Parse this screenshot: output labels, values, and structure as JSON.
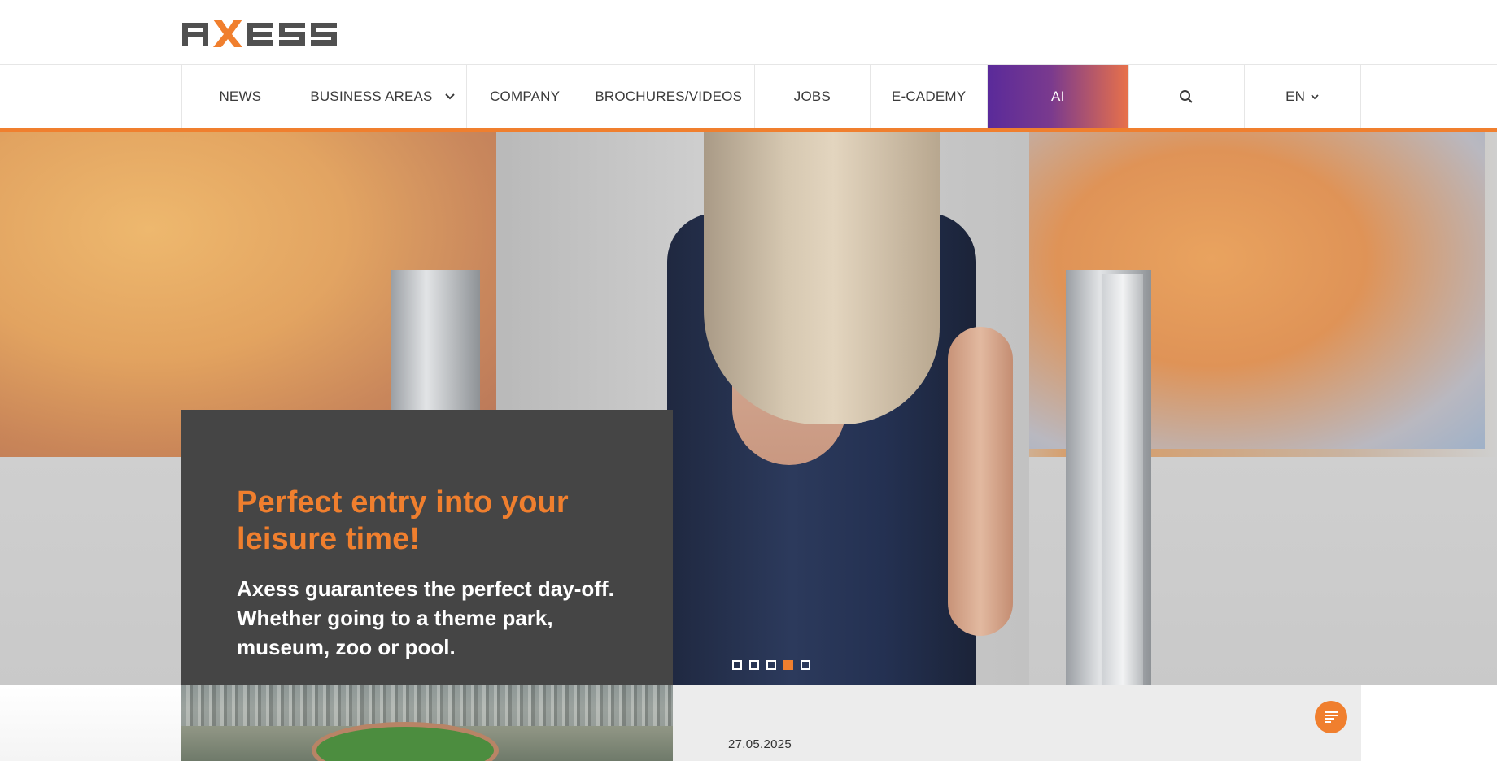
{
  "brand": {
    "name": "AXESS",
    "accent": "#f07f2e",
    "ai_gradient_start": "#5a2a9a",
    "ai_gradient_end": "#e8714a"
  },
  "nav": {
    "items": [
      {
        "label": "NEWS"
      },
      {
        "label": "BUSINESS AREAS"
      },
      {
        "label": "COMPANY"
      },
      {
        "label": "BROCHURES/VIDEOS"
      },
      {
        "label": "JOBS"
      },
      {
        "label": "E-CADEMY"
      },
      {
        "label": "AI"
      }
    ],
    "search_icon": "search-icon",
    "language": "EN"
  },
  "hero": {
    "headline": "Perfect entry into your leisure time!",
    "body": "Axess guarantees the perfect day-off. Whether going to a theme park, museum, zoo or pool.",
    "slides_total": 5,
    "active_slide": 4
  },
  "news": {
    "date": "27.05.2025"
  },
  "chat": {
    "icon": "chat-icon"
  }
}
